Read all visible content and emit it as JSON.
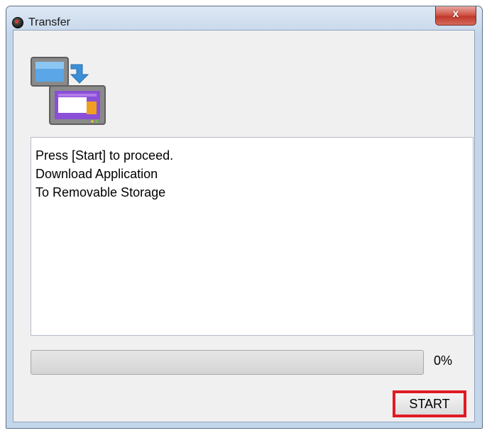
{
  "window": {
    "title": "Transfer",
    "close_label": "x",
    "icons": {
      "app": "app-logo-icon",
      "close": "close-icon",
      "transfer": "transfer-to-device-icon"
    }
  },
  "message": {
    "lines": [
      "Press [Start] to proceed.",
      "Download Application",
      "To Removable Storage"
    ]
  },
  "progress": {
    "value_fraction": 0,
    "label": "0%"
  },
  "actions": {
    "start_label": "START"
  },
  "colors": {
    "highlight": "#e01b24",
    "close_button": "#c0392b"
  }
}
